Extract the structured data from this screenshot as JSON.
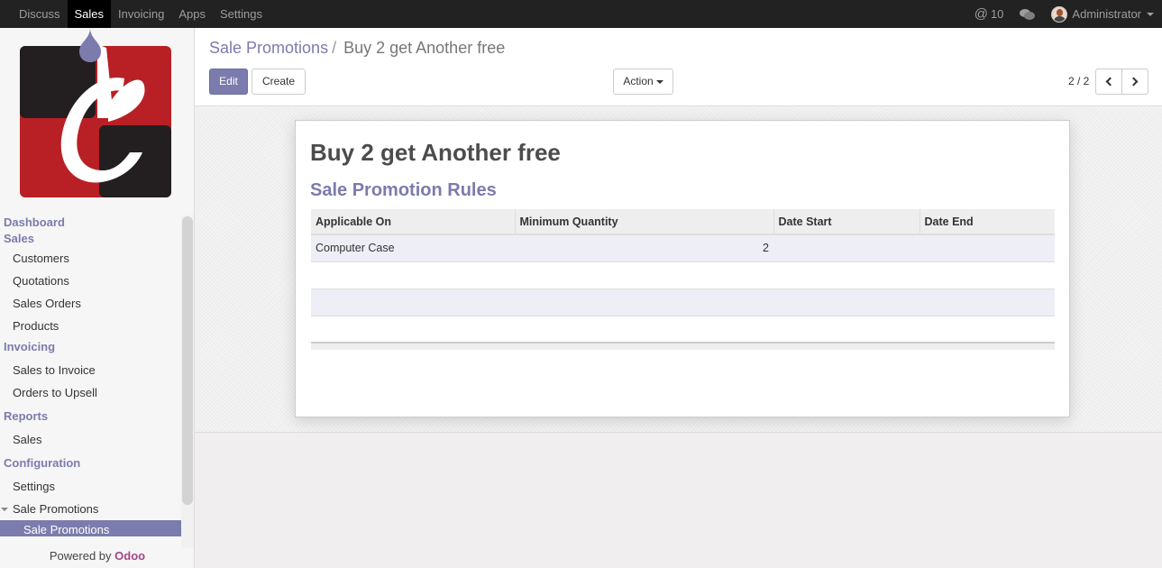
{
  "topbar": {
    "menu": [
      {
        "label": "Discuss",
        "active": false
      },
      {
        "label": "Sales",
        "active": true
      },
      {
        "label": "Invoicing",
        "active": false
      },
      {
        "label": "Apps",
        "active": false
      },
      {
        "label": "Settings",
        "active": false
      }
    ],
    "mentions_count": "10",
    "mention_symbol": "@",
    "user_name": "Administrator"
  },
  "sidebar": {
    "dashboard": "Dashboard",
    "sales": "Sales",
    "sales_items": [
      "Customers",
      "Quotations",
      "Sales Orders",
      "Products"
    ],
    "invoicing": "Invoicing",
    "invoicing_items": [
      "Sales to Invoice",
      "Orders to Upsell"
    ],
    "reports": "Reports",
    "reports_items": [
      "Sales"
    ],
    "configuration": "Configuration",
    "configuration_items": [
      "Settings",
      "Sale Promotions"
    ],
    "active_item": "Sale Promotions",
    "powered_by": "Powered by",
    "powered_brand": "Odoo"
  },
  "control": {
    "breadcrumb_parent": "Sale Promotions",
    "breadcrumb_sep": "/",
    "breadcrumb_current": "Buy 2 get Another free",
    "edit_label": "Edit",
    "create_label": "Create",
    "action_label": "Action",
    "pager": "2 / 2"
  },
  "record": {
    "title": "Buy 2 get Another free",
    "section_title": "Sale Promotion Rules",
    "columns": [
      "Applicable On",
      "Minimum Quantity",
      "Date Start",
      "Date End"
    ],
    "rows": [
      {
        "applicable_on": "Computer Case",
        "min_qty": "2",
        "date_start": "",
        "date_end": ""
      }
    ]
  },
  "colors": {
    "brand": "#7c7bad",
    "topbar": "#222222",
    "logo_red": "#b82025",
    "logo_dark": "#231f20",
    "logo_drop": "#7c7bad"
  }
}
